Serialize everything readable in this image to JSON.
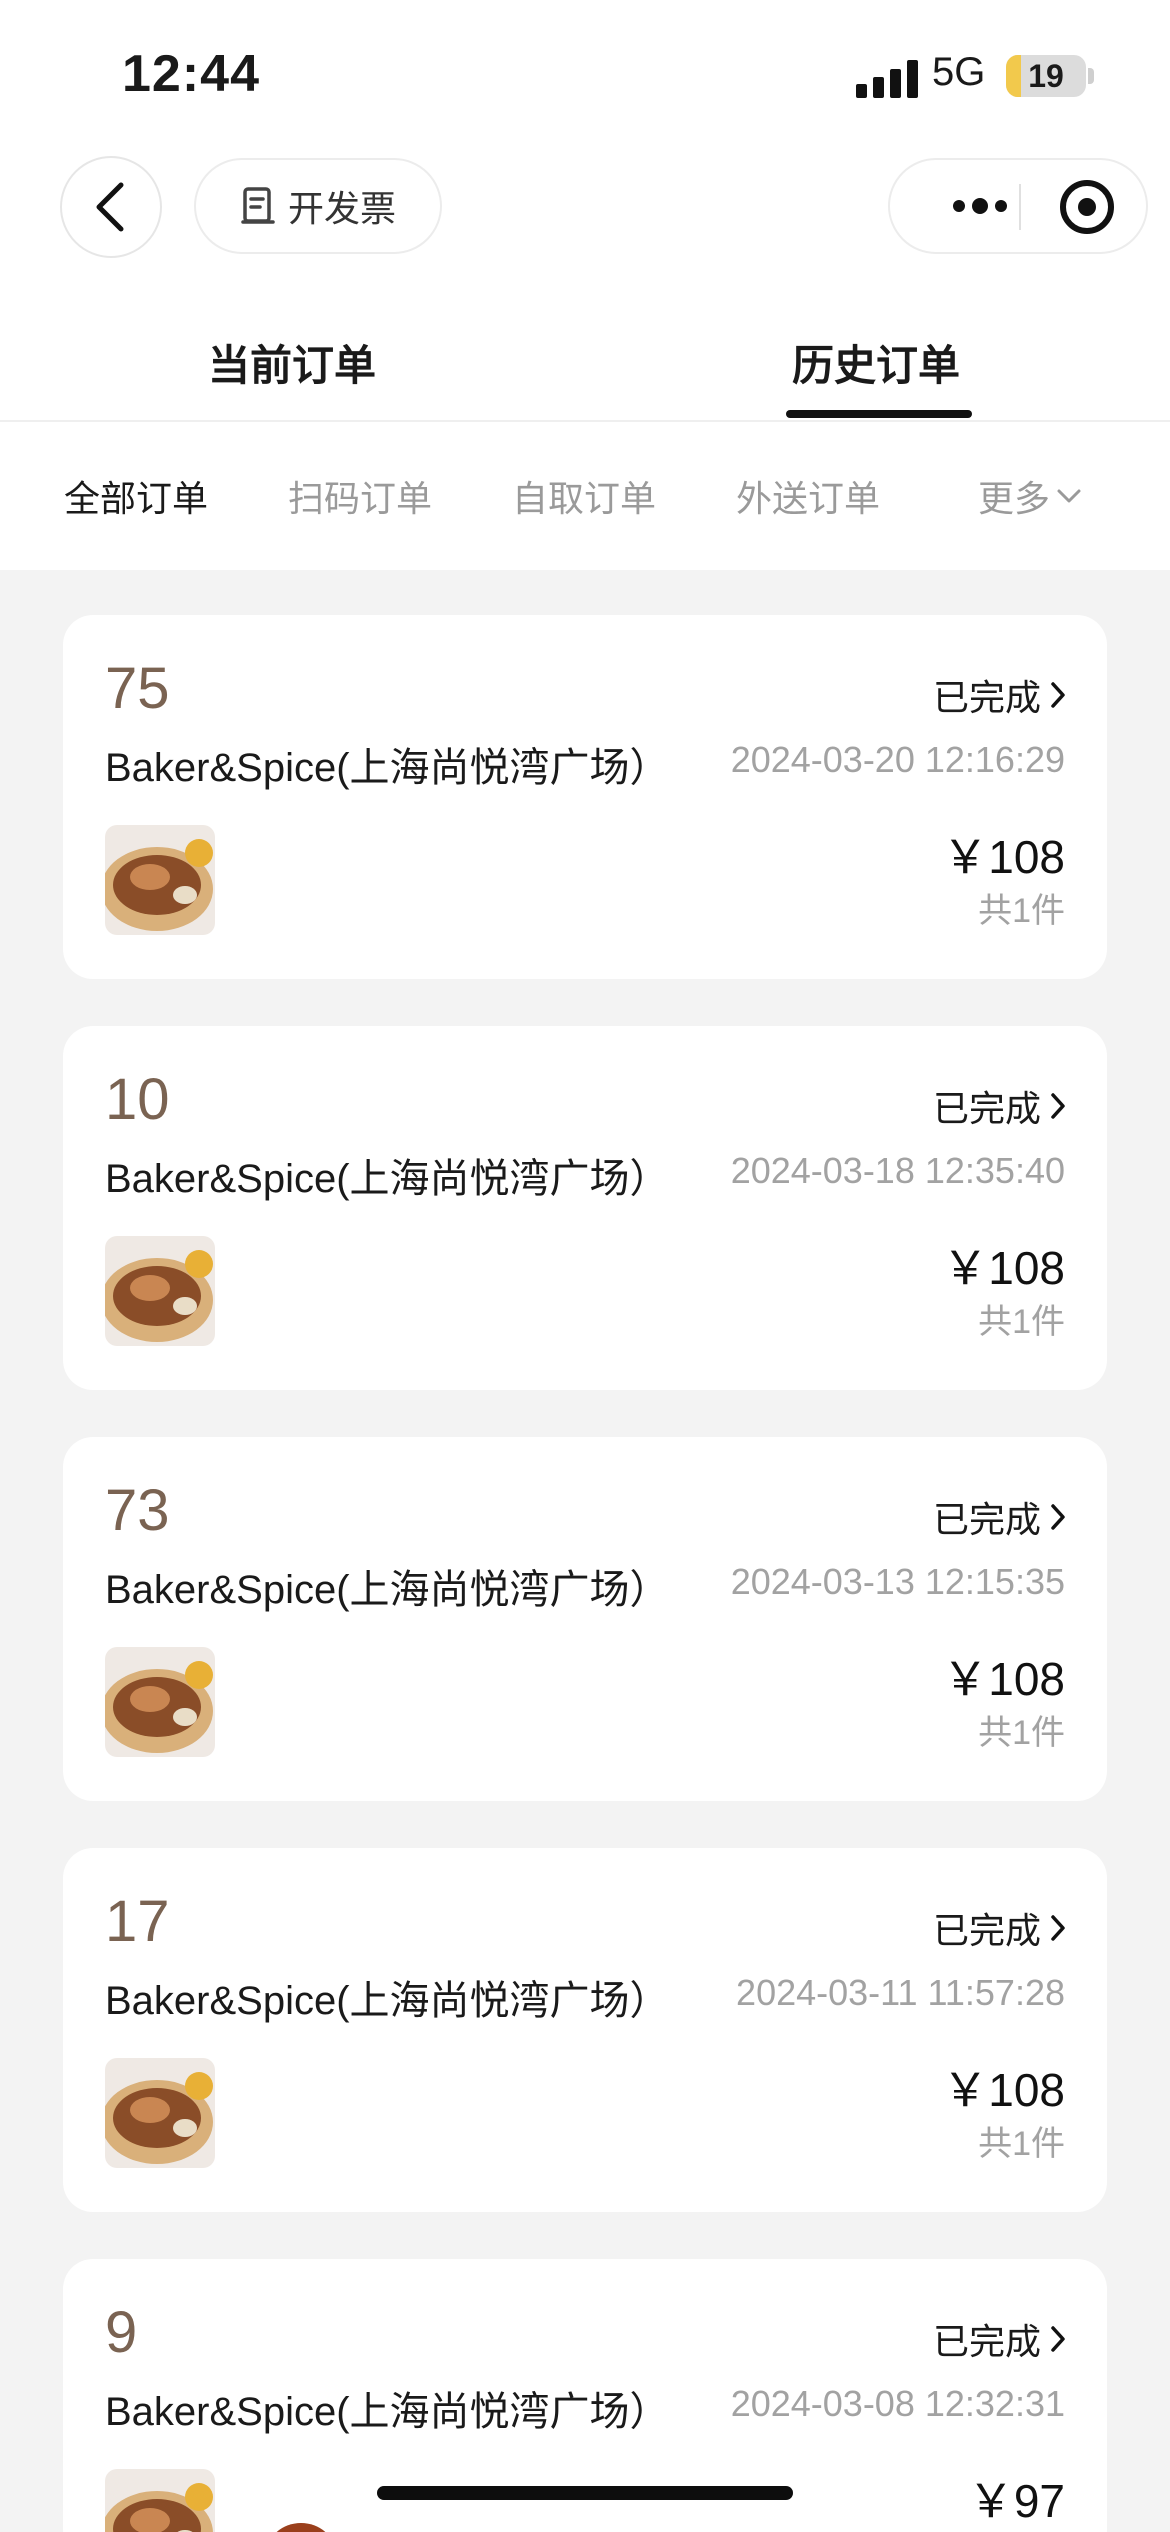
{
  "status_bar": {
    "time": "12:44",
    "network": "5G",
    "battery": "19",
    "battery_level_percent": 19
  },
  "nav": {
    "back_icon": "chevron-left-icon",
    "invoice_label": "开发票",
    "invoice_icon": "receipt-icon",
    "more_icon": "more-dots-icon",
    "close_icon": "target-circle-icon"
  },
  "tabs": {
    "current": "当前订单",
    "history": "历史订单",
    "active": "history"
  },
  "filters": {
    "items": [
      "全部订单",
      "扫码订单",
      "自取订单",
      "外送订单",
      "更多"
    ],
    "active_index": 0,
    "more_icon": "chevron-down-icon"
  },
  "orders": [
    {
      "number": "75",
      "status": "已完成",
      "store": "Baker&Spice(上海尚悦湾广场）",
      "time": "2024-03-20 12:16:29",
      "price": "￥108",
      "count": "共1件"
    },
    {
      "number": "10",
      "status": "已完成",
      "store": "Baker&Spice(上海尚悦湾广场）",
      "time": "2024-03-18 12:35:40",
      "price": "￥108",
      "count": "共1件"
    },
    {
      "number": "73",
      "status": "已完成",
      "store": "Baker&Spice(上海尚悦湾广场）",
      "time": "2024-03-13 12:15:35",
      "price": "￥108",
      "count": "共1件"
    },
    {
      "number": "17",
      "status": "已完成",
      "store": "Baker&Spice(上海尚悦湾广场）",
      "time": "2024-03-11 11:57:28",
      "price": "￥108",
      "count": "共1件"
    },
    {
      "number": "9",
      "status": "已完成",
      "store": "Baker&Spice(上海尚悦湾广场）",
      "time": "2024-03-08 12:32:31",
      "price": "￥97",
      "count": ""
    }
  ],
  "colors": {
    "order_number": "#7a6352",
    "muted_text": "#a2a2a2",
    "page_bg": "#f3f3f3",
    "battery_fill": "#f2c94c"
  }
}
